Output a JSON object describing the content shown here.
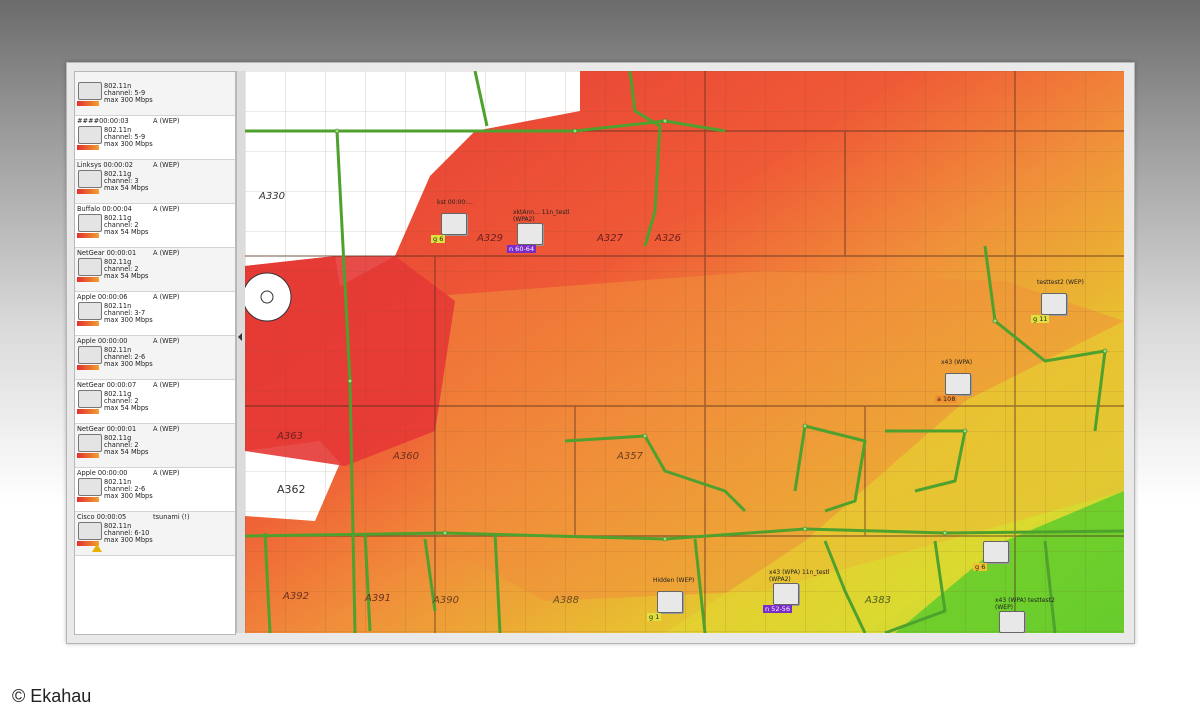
{
  "colors": {
    "heat_red": "#e53935",
    "heat_orange": "#f08a3a",
    "heat_yellow": "#e8e030",
    "heat_green": "#3ec830",
    "path_green": "#4fa12e"
  },
  "sidebar": {
    "items": [
      {
        "name": "",
        "encryption": "",
        "standard": "802.11n",
        "channel": "channel: 5-9",
        "rate": "max 300 Mbps"
      },
      {
        "name": "####00:00:03",
        "encryption": "A (WEP)",
        "standard": "802.11n",
        "channel": "channel: 5-9",
        "rate": "max 300 Mbps"
      },
      {
        "name": "Linksys 00:00:02",
        "encryption": "A (WEP)",
        "standard": "802.11g",
        "channel": "channel: 3",
        "rate": "max 54 Mbps"
      },
      {
        "name": "Buffalo 00:00:04",
        "encryption": "A (WEP)",
        "standard": "802.11g",
        "channel": "channel: 2",
        "rate": "max 54 Mbps"
      },
      {
        "name": "NetGear 00:00:01",
        "encryption": "A (WEP)",
        "standard": "802.11g",
        "channel": "channel: 2",
        "rate": "max 54 Mbps"
      },
      {
        "name": "Apple 00:00:06",
        "encryption": "A (WEP)",
        "standard": "802.11n",
        "channel": "channel: 3-7",
        "rate": "max 300 Mbps"
      },
      {
        "name": "Apple 00:00:00",
        "encryption": "A (WEP)",
        "standard": "802.11n",
        "channel": "channel: 2-6",
        "rate": "max 300 Mbps"
      },
      {
        "name": "NetGear 00:00:07",
        "encryption": "A (WEP)",
        "standard": "802.11g",
        "channel": "channel: 2",
        "rate": "max 54 Mbps"
      },
      {
        "name": "NetGear 00:00:01",
        "encryption": "A (WEP)",
        "standard": "802.11g",
        "channel": "channel: 2",
        "rate": "max 54 Mbps"
      },
      {
        "name": "Apple 00:00:00",
        "encryption": "A (WEP)",
        "standard": "802.11n",
        "channel": "channel: 2-6",
        "rate": "max 300 Mbps"
      },
      {
        "name": "Cisco 00:00:05",
        "encryption": "tsunami (!)",
        "standard": "802.11n",
        "channel": "channel: 6-10",
        "rate": "max 300 Mbps"
      }
    ]
  },
  "map": {
    "rooms": [
      "A362",
      "A363",
      "A360",
      "A357",
      "A392",
      "A391",
      "A390",
      "A388",
      "A383",
      "A329",
      "A327",
      "A326",
      "A330"
    ],
    "access_points": [
      {
        "label": "kst 00:00:...",
        "badge": "g 6"
      },
      {
        "label": "xktAnn... 11n_testl (WPA2)",
        "badge": "n 60-64"
      },
      {
        "label": "testtest2 (WEP)",
        "badge": "g 11"
      },
      {
        "label": "x43 (WPA)",
        "badge": "a 108"
      },
      {
        "label": "",
        "badge": "g 6"
      },
      {
        "label": "Hidden (WEP)",
        "badge": "g 1"
      },
      {
        "label": "x43 (WPA) 11n_testl (WPA2)",
        "badge": "n 52-56"
      },
      {
        "label": "x43 (WPA) testtest2 (WEP)",
        "badge": ""
      }
    ]
  },
  "copyright": "© Ekahau"
}
